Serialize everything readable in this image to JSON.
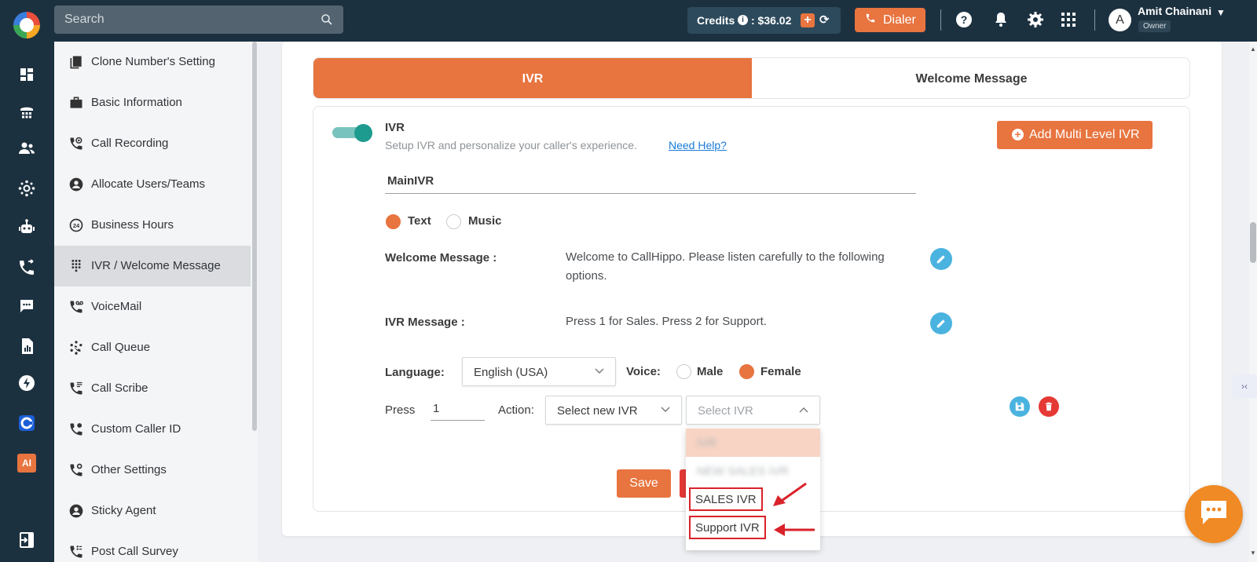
{
  "topbar": {
    "search_placeholder": "Search",
    "credits_label": "Credits",
    "credits_info": "i",
    "credits_amount": ": $36.02",
    "credits_plus": "+",
    "dialer_label": "Dialer",
    "user_initial": "A",
    "user_name": "Amit Chainani",
    "user_role": "Owner"
  },
  "rail_icons": [
    "dashboard-icon",
    "dialpad-icon",
    "contacts-icon",
    "integrations-icon",
    "bot-icon",
    "call-logs-icon",
    "chat-icon",
    "reports-icon",
    "power-dialer-icon",
    "callhippo-c-icon",
    "ai-icon",
    "logout-icon"
  ],
  "rail_ai_label": "AI",
  "nav": {
    "items": [
      {
        "label": "Clone Number's Setting",
        "icon": "clone-icon"
      },
      {
        "label": "Basic Information",
        "icon": "briefcase-icon"
      },
      {
        "label": "Call Recording",
        "icon": "call-recording-icon"
      },
      {
        "label": "Allocate Users/Teams",
        "icon": "user-circle-icon"
      },
      {
        "label": "Business Hours",
        "icon": "business-hours-icon"
      },
      {
        "label": "IVR / Welcome Message",
        "icon": "dialpad-icon",
        "active": true
      },
      {
        "label": "VoiceMail",
        "icon": "voicemail-icon"
      },
      {
        "label": "Call Queue",
        "icon": "call-queue-icon"
      },
      {
        "label": "Call Scribe",
        "icon": "call-scribe-icon"
      },
      {
        "label": "Custom Caller ID",
        "icon": "caller-id-icon"
      },
      {
        "label": "Other Settings",
        "icon": "settings-phone-icon"
      },
      {
        "label": "Sticky Agent",
        "icon": "user-circle-icon"
      },
      {
        "label": "Post Call Survey",
        "icon": "survey-icon"
      }
    ]
  },
  "tabs": {
    "ivr": "IVR",
    "welcome": "Welcome Message"
  },
  "ivr": {
    "title": "IVR",
    "subtitle": "Setup IVR and personalize your caller's experience.",
    "help_link": "Need Help?",
    "multi_level_button": "Add Multi Level IVR",
    "name_value": "MainIVR",
    "type_text": "Text",
    "type_music": "Music",
    "welcome_label": "Welcome Message :",
    "welcome_value": "Welcome to CallHippo. Please listen carefully to the following options.",
    "ivr_msg_label": "IVR Message :",
    "ivr_msg_value": "Press 1 for Sales. Press 2 for Support.",
    "language_label": "Language:",
    "language_value": "English (USA)",
    "voice_label": "Voice:",
    "voice_male": "Male",
    "voice_female": "Female",
    "press_label": "Press",
    "press_value": "1",
    "action_label": "Action:",
    "action_value": "Select new IVR",
    "select_ivr_placeholder": "Select IVR",
    "save_button": "Save"
  },
  "dropdown": {
    "options": [
      "IVR",
      "NEW SALES IVR",
      "SALES IVR",
      "Support IVR"
    ]
  },
  "colors": {
    "accent": "#e8743f",
    "topbar": "#1c3140",
    "annotation_red": "#d9222a",
    "toggle_on": "#1d9b8e",
    "edit_blue": "#4ab3df",
    "delete_red": "#e53935"
  },
  "side_tab_label": "›‹"
}
